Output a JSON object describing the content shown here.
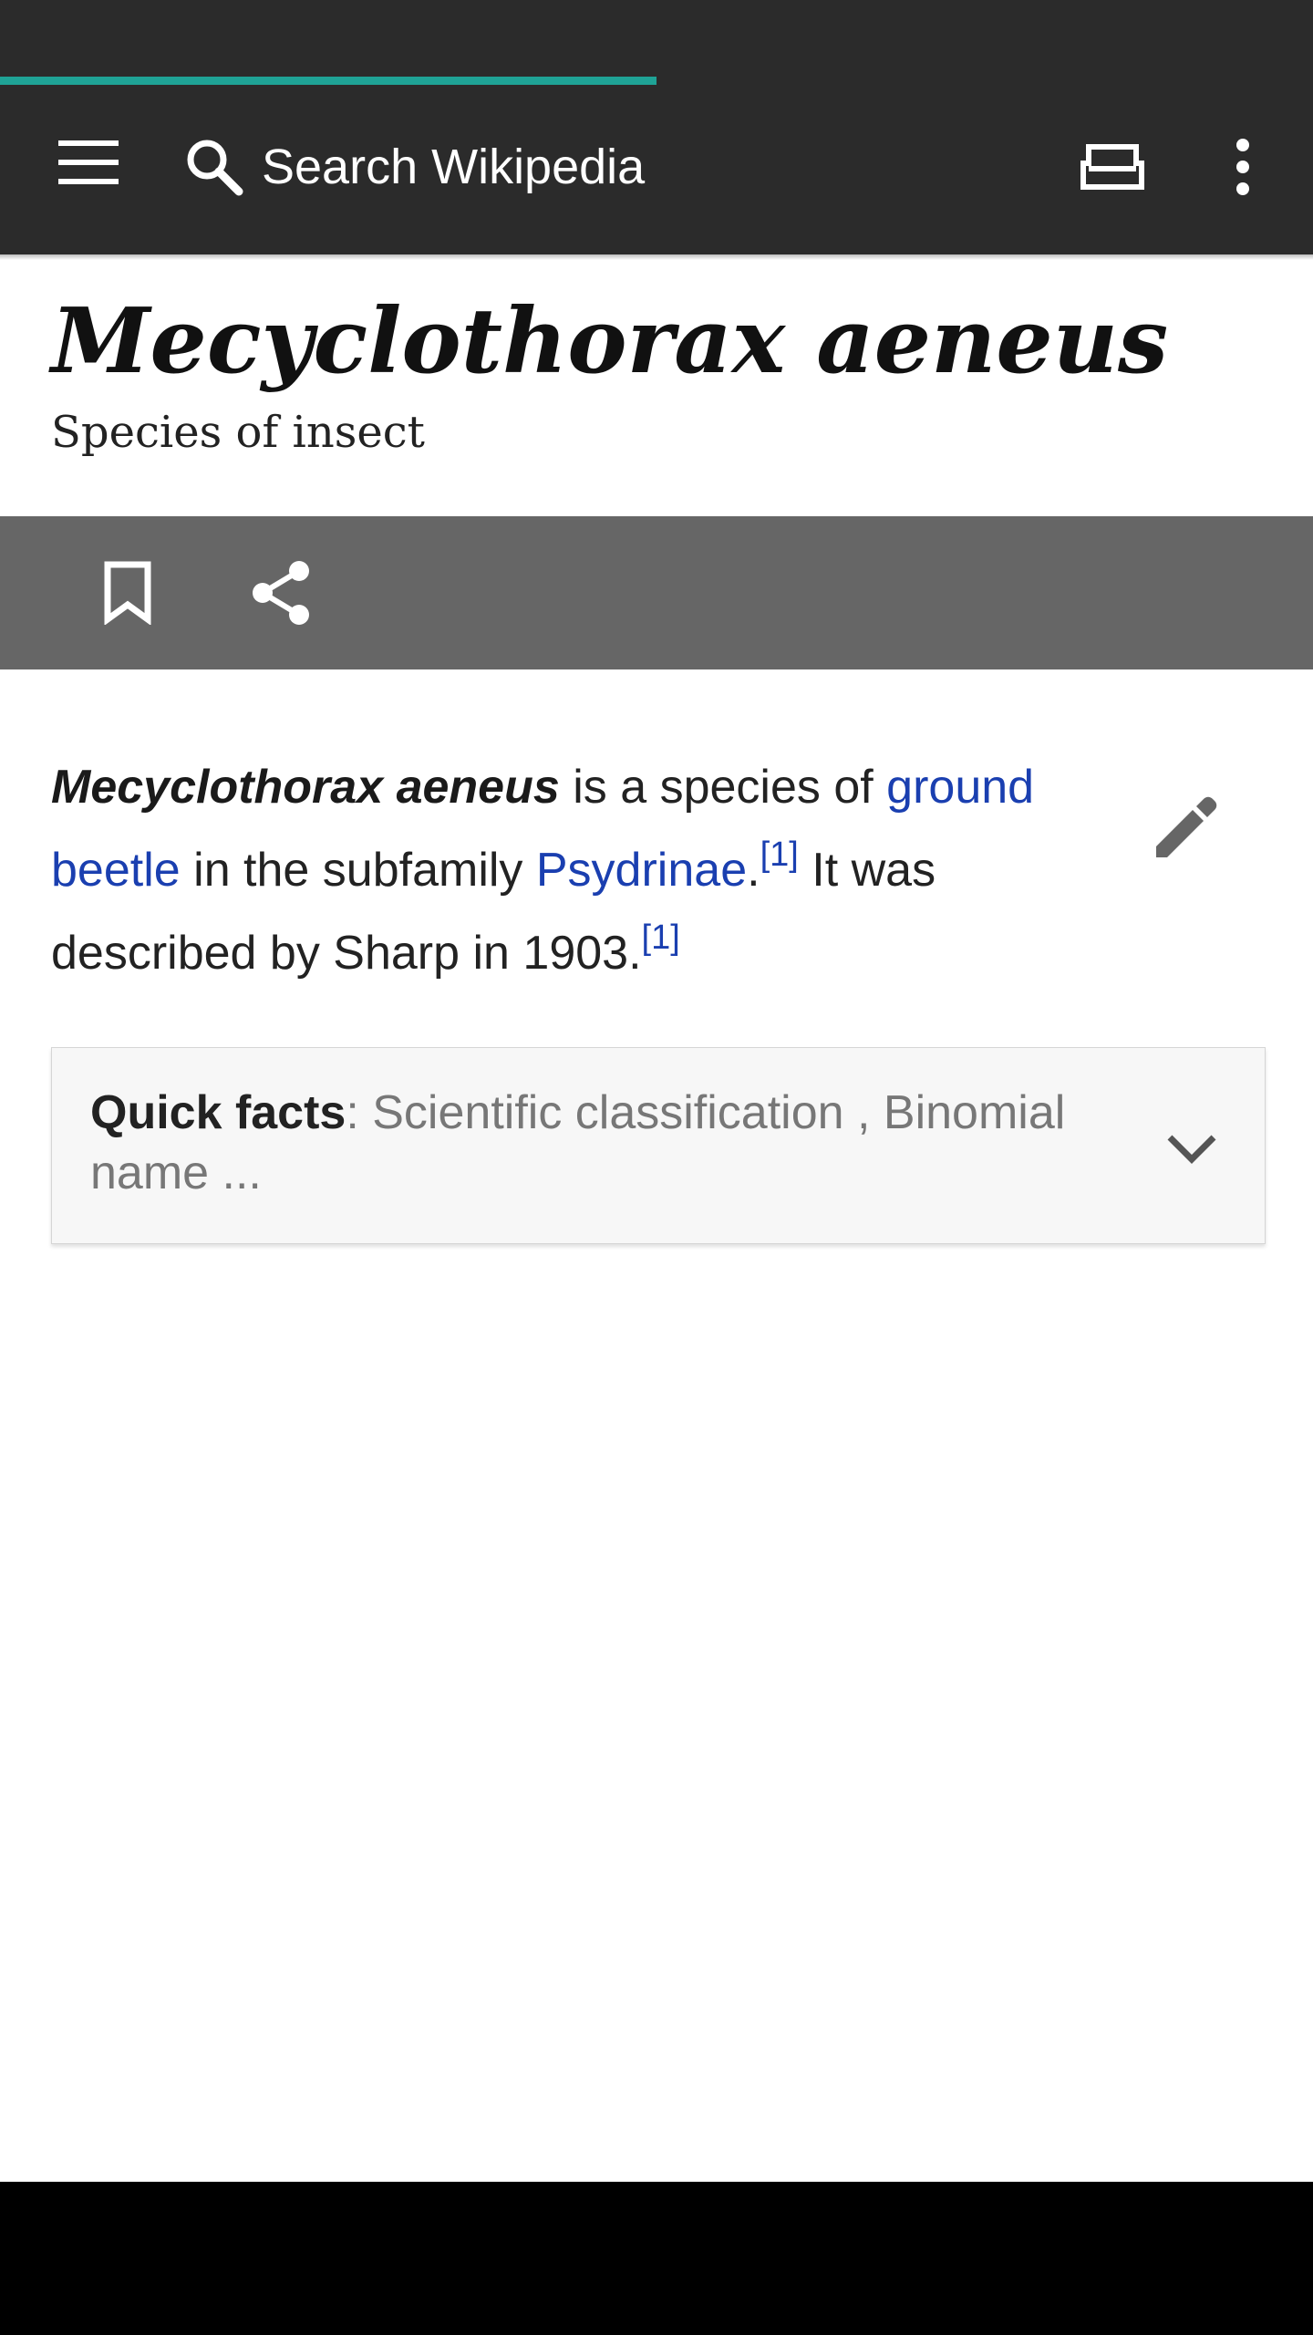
{
  "app": {
    "loading_progress_percent": 50,
    "colors": {
      "toolbar": "#2b2b2b",
      "progress": "#1fa396",
      "action_bar": "#666666",
      "link": "#1a3fb0"
    }
  },
  "toolbar": {
    "menu_icon": "hamburger-menu-icon",
    "search_icon": "search-icon",
    "search_placeholder": "Search Wikipedia",
    "tabs_icon": "tabs-icon",
    "overflow_icon": "more-vertical-icon"
  },
  "article": {
    "title": "Mecyclothorax aeneus",
    "description": "Species of insect"
  },
  "actions": {
    "bookmark_icon": "bookmark-icon",
    "share_icon": "share-icon"
  },
  "lead": {
    "bold_name": "Mecyclothorax aeneus",
    "text_1": " is a species of ",
    "link_1": "ground beetle",
    "text_2": " in the subfamily ",
    "link_2": "Psydrinae",
    "text_3": ".",
    "ref_1": "[1]",
    "text_4": " It was described by Sharp in 1903.",
    "ref_2": "[1]",
    "edit_icon": "pencil-icon"
  },
  "quick_facts": {
    "label": "Quick facts",
    "summary": ": Scientific classification , Binomial name ...",
    "chevron_icon": "chevron-down-icon"
  }
}
